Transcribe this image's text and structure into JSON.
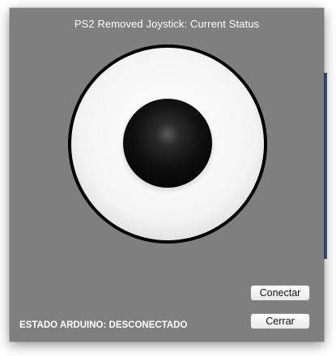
{
  "window": {
    "title": "PS2 Removed Joystick: Current Status",
    "background_color": "#7f7f7f"
  },
  "joystick": {
    "outer_ring_color": "#ffffff",
    "stick_color": "#111111"
  },
  "status": {
    "text": "ESTADO ARDUINO: DESCONECTADO"
  },
  "buttons": {
    "connect_label": "Conectar",
    "close_label": "Cerrar"
  }
}
